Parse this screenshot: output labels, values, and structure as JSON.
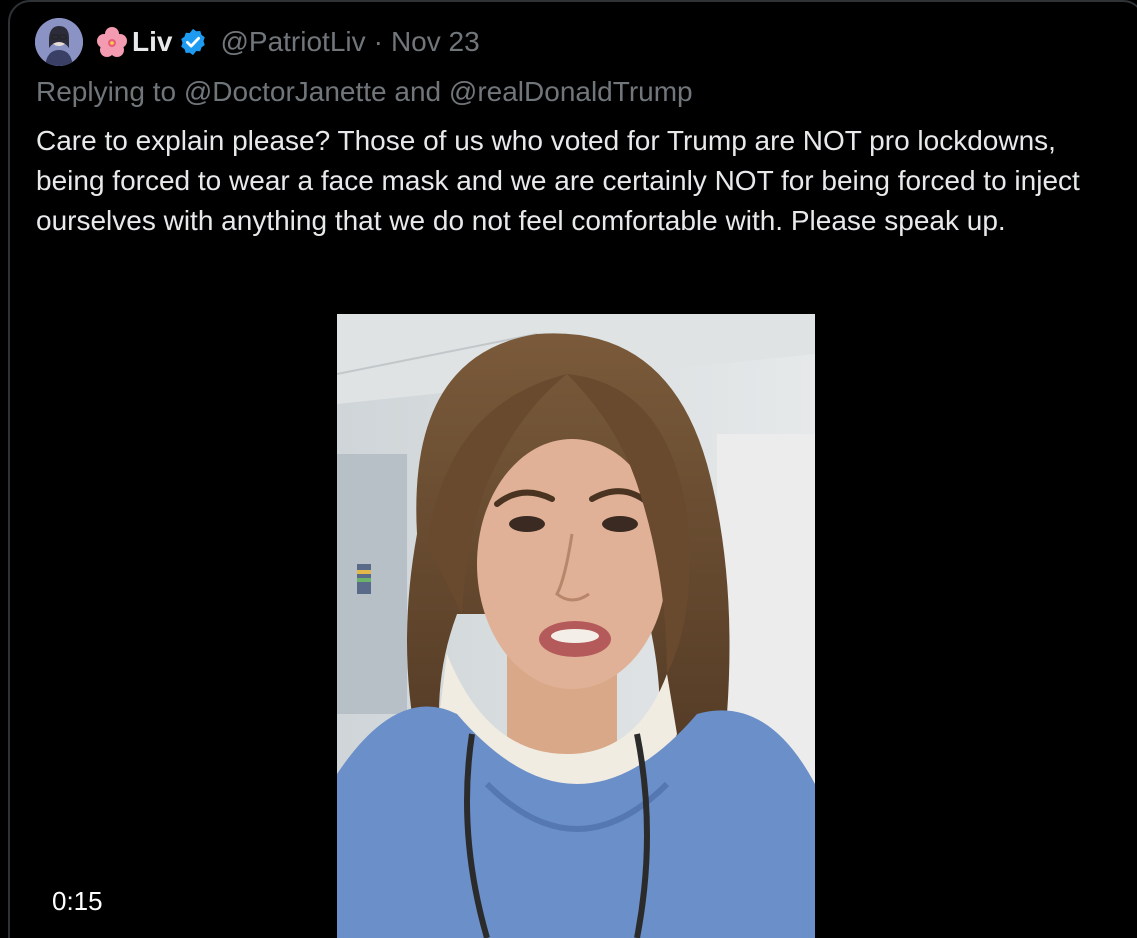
{
  "tweet": {
    "emoji": "🌺",
    "display_name": "Liv",
    "handle": "@PatriotLiv",
    "separator": "·",
    "date": "Nov 23",
    "reply_prefix": "Replying to",
    "reply_to_1": "@DoctorJanette",
    "reply_and": "and",
    "reply_to_2": "@realDonaldTrump",
    "text": "Care to explain please? Those of us who voted for Trump are NOT pro lockdowns, being forced to wear a face mask and we are certainly NOT for being forced to inject ourselves with anything that we do not feel comfortable with. Please speak up."
  },
  "video": {
    "duration": "0:15"
  },
  "colors": {
    "background": "#000000",
    "text_primary": "#e7e9ea",
    "text_secondary": "#71767b",
    "verified_blue": "#1d9bf0",
    "border": "#2f3336"
  },
  "icons": [
    "avatar",
    "hibiscus-emoji-icon",
    "verified-badge-icon"
  ]
}
